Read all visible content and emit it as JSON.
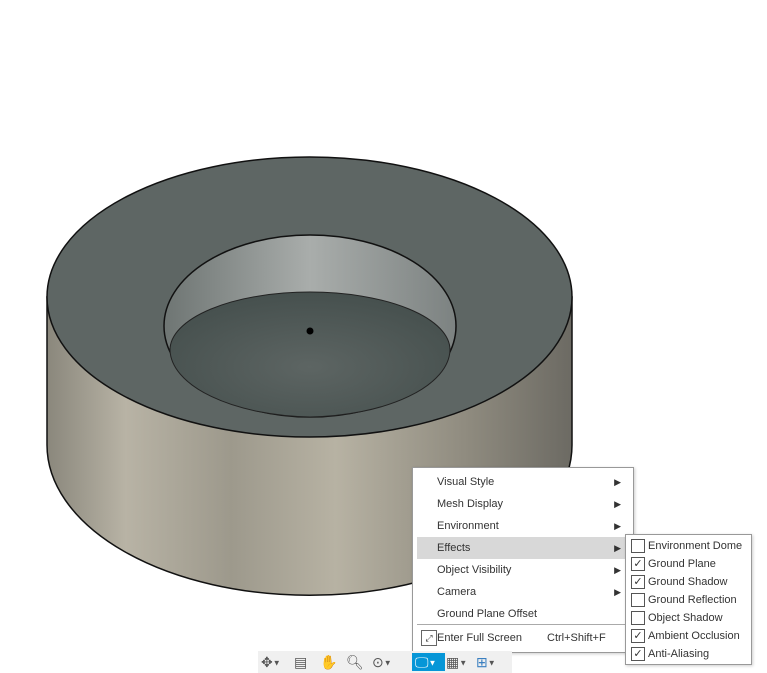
{
  "menu": {
    "items": [
      {
        "label": "Visual Style",
        "submenu": true
      },
      {
        "label": "Mesh Display",
        "submenu": true
      },
      {
        "label": "Environment",
        "submenu": true
      },
      {
        "label": "Effects",
        "submenu": true,
        "highlighted": true
      },
      {
        "label": "Object Visibility",
        "submenu": true
      },
      {
        "label": "Camera",
        "submenu": true
      },
      {
        "label": "Ground Plane Offset",
        "submenu": false
      }
    ],
    "fullscreen": {
      "label": "Enter Full Screen",
      "shortcut": "Ctrl+Shift+F"
    },
    "arrow": "▶"
  },
  "effects": {
    "items": [
      {
        "label": "Environment Dome",
        "checked": false
      },
      {
        "label": "Ground Plane",
        "checked": true
      },
      {
        "label": "Ground Shadow",
        "checked": true
      },
      {
        "label": "Ground Reflection",
        "checked": false
      },
      {
        "label": "Object Shadow",
        "checked": false
      },
      {
        "label": "Ambient Occlusion",
        "checked": true
      },
      {
        "label": "Anti-Aliasing",
        "checked": true
      }
    ]
  },
  "toolbar": {
    "items": [
      "orbit-icon",
      "look-at-icon",
      "pan-icon",
      "zoom-icon",
      "fit-icon",
      "display-settings-icon",
      "grid-settings-icon",
      "viewports-icon"
    ],
    "accent": "#0696d7"
  }
}
